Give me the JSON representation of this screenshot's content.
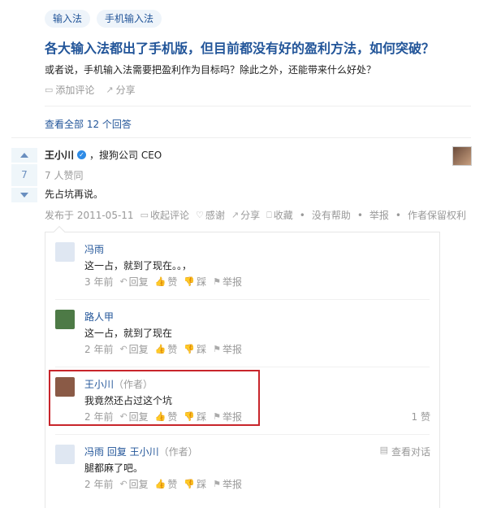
{
  "topics": [
    "输入法",
    "手机输入法"
  ],
  "question": {
    "title": "各大输入法都出了手机版，但目前都没有好的盈利方法，如何突破？",
    "detail": "或者说，手机输入法需要把盈利作为目标吗？除此之外，还能带来什么好处？",
    "add_comment": "添加评论",
    "share": "分享"
  },
  "view_all": "查看全部 12 个回答",
  "answer": {
    "votes": "7",
    "author": "王小川",
    "bio": "，搜狗公司 CEO",
    "upvoters": "7 人赞同",
    "content": "先占坑再说。",
    "date": "发布于 2011-05-11",
    "actions": {
      "collapse_comments": "收起评论",
      "thanks": "感谢",
      "share": "分享",
      "collect": "收藏",
      "no_help": "没有帮助",
      "report": "举报",
      "copyright": "作者保留权利"
    }
  },
  "comments": [
    {
      "author": "冯雨",
      "role": "",
      "reply_to": "",
      "text": "这一占，就到了现在。。，",
      "time": "3 年前",
      "likes": "",
      "avatar_color": "#dfe7f2"
    },
    {
      "author": "路人甲",
      "role": "",
      "reply_to": "",
      "text": "这一占，就到了现在",
      "time": "2 年前",
      "likes": "",
      "avatar_color": "#4d7a46"
    },
    {
      "author": "王小川",
      "role": "（作者）",
      "reply_to": "",
      "text": "我竟然还占过这个坑",
      "time": "2 年前",
      "likes": "1 赞",
      "avatar_color": "#8a5a46"
    },
    {
      "author": "冯雨",
      "role": "（作者）",
      "reply_to": " 回复 王小川",
      "text": "腿都麻了吧。",
      "time": "2 年前",
      "likes": "",
      "view_conversation": "查看对话",
      "avatar_color": "#dfe7f2"
    }
  ],
  "comment_actions": {
    "reply": "回复",
    "like": "赞",
    "dislike": "踩",
    "report": "举报"
  },
  "colors": {
    "link": "#225599",
    "highlight_border": "#c8252b",
    "meta": "#999999"
  }
}
